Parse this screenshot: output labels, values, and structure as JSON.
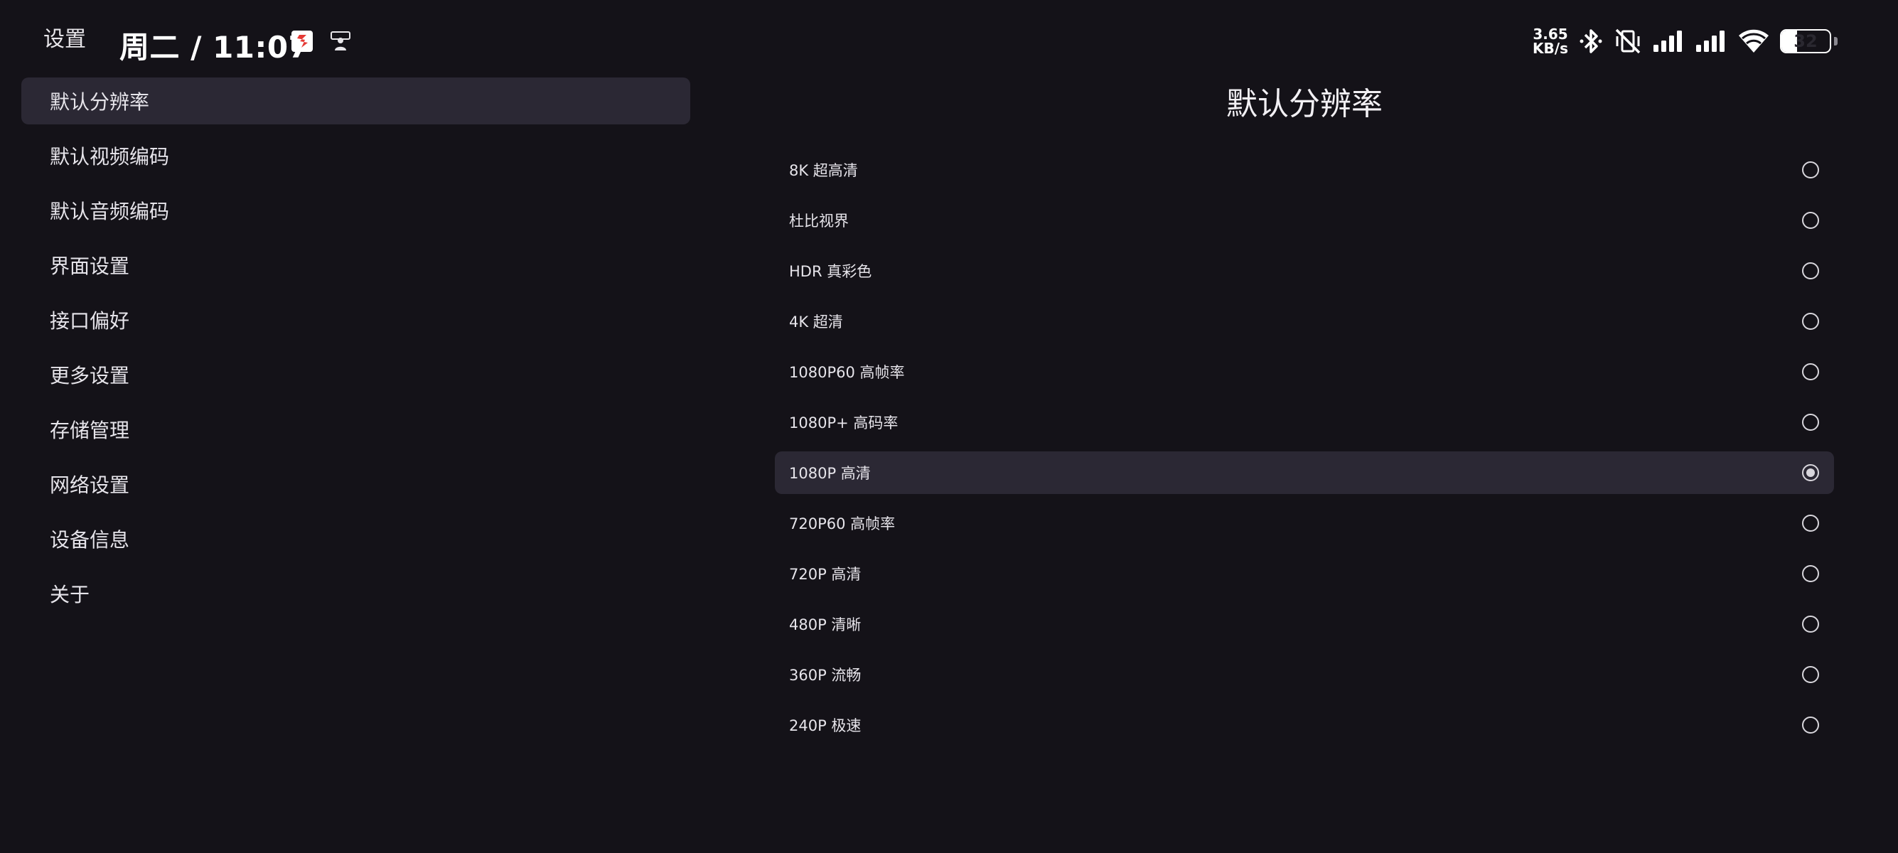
{
  "status_bar": {
    "app_title": "设置",
    "clock": "周二 / 11:07",
    "net_speed_value": "3.65",
    "net_speed_unit": "KB/s",
    "battery_level": "32",
    "icons": [
      "app-s-icon",
      "user-badge-icon",
      "bluetooth-icon",
      "vibrate-off-icon",
      "signal-icon",
      "signal-icon",
      "wifi-icon",
      "battery-icon"
    ]
  },
  "sidebar": {
    "items": [
      {
        "label": "默认分辨率"
      },
      {
        "label": "默认视频编码"
      },
      {
        "label": "默认音频编码"
      },
      {
        "label": "界面设置"
      },
      {
        "label": "接口偏好"
      },
      {
        "label": "更多设置"
      },
      {
        "label": "存储管理"
      },
      {
        "label": "网络设置"
      },
      {
        "label": "设备信息"
      },
      {
        "label": "关于"
      }
    ],
    "selected_index": 0
  },
  "panel": {
    "title": "默认分辨率",
    "options": [
      {
        "label": "8K 超高清"
      },
      {
        "label": "杜比视界"
      },
      {
        "label": "HDR 真彩色"
      },
      {
        "label": "4K 超清"
      },
      {
        "label": "1080P60 高帧率"
      },
      {
        "label": "1080P+ 高码率"
      },
      {
        "label": "1080P 高清"
      },
      {
        "label": "720P60 高帧率"
      },
      {
        "label": "720P 高清"
      },
      {
        "label": "480P 清晰"
      },
      {
        "label": "360P 流畅"
      },
      {
        "label": "240P 极速"
      }
    ],
    "selected_index": 6
  },
  "colors": {
    "background": "#141218",
    "selected_bg": "#2b2834",
    "text": "#e6e4ea",
    "accent_red": "#e53935"
  }
}
